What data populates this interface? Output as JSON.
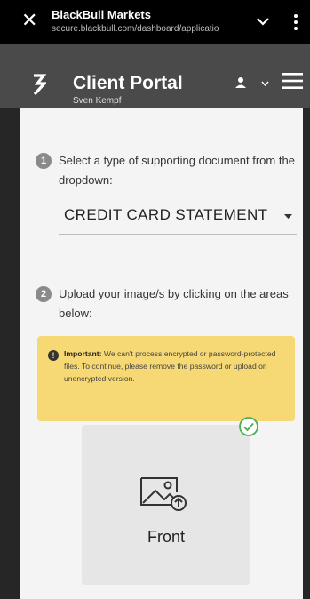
{
  "browser": {
    "site_title": "BlackBull Markets",
    "url": "secure.blackbull.com/dashboard/applicatio",
    "icons": [
      "close-icon",
      "chevron-down-icon",
      "more-vert-icon"
    ]
  },
  "header": {
    "title": "Client Portal",
    "user_name": "Sven Kempf",
    "icons": [
      "logo",
      "user-icon",
      "caret-down-icon",
      "menu-icon"
    ]
  },
  "steps": [
    {
      "number": "1",
      "text": "Select a type of supporting document from the dropdown:"
    },
    {
      "number": "2",
      "text": "Upload your image/s by clicking on the areas below:"
    }
  ],
  "dropdown": {
    "selected": "CREDIT CARD STATEMENT"
  },
  "notice": {
    "icon": "info-icon",
    "strong": "Important:",
    "text": " We can't process encrypted or password-protected files. To continue, please remove the password or upload on unencrypted version."
  },
  "upload": {
    "label": "Front",
    "status": "uploaded",
    "status_icon": "check-circle-icon"
  },
  "colors": {
    "header_bg": "#4a4a4a",
    "notice_bg": "#f6d874",
    "check": "#4caf50",
    "content_bg": "#f4f4f4"
  }
}
